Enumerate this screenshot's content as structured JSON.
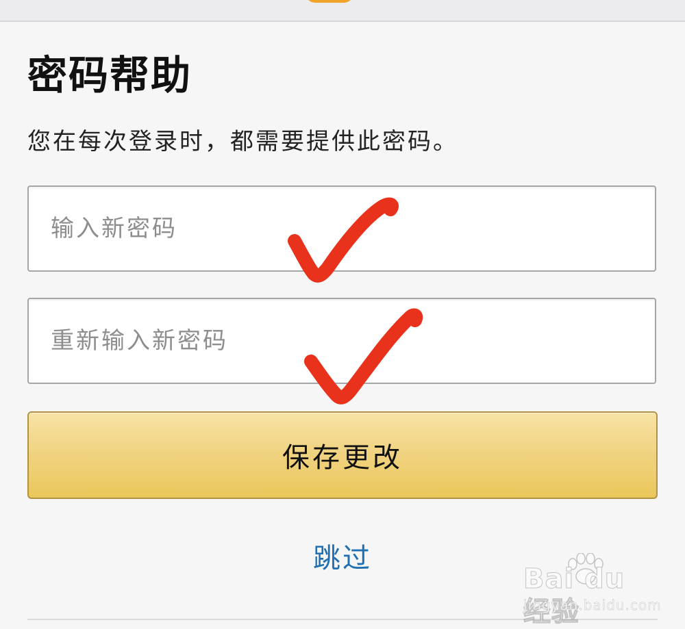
{
  "header": {
    "logo_icon": "brand-logo-icon"
  },
  "page": {
    "title": "密码帮助",
    "description": "您在每次登录时，都需要提供此密码。"
  },
  "form": {
    "new_password": {
      "value": "",
      "placeholder": "输入新密码"
    },
    "confirm_password": {
      "value": "",
      "placeholder": "重新输入新密码"
    },
    "save_label": "保存更改",
    "skip_label": "跳过"
  },
  "annotations": {
    "check_icon": "checkmark-icon",
    "check_color": "#e8321c"
  },
  "watermark": {
    "logo_text": "Bai du 经验",
    "url": "jingyan.baidu.com"
  },
  "colors": {
    "button_gradient_top": "#f7e3a5",
    "button_gradient_bottom": "#eac75a",
    "link": "#1f6fb2",
    "background": "#f6f6f7"
  }
}
